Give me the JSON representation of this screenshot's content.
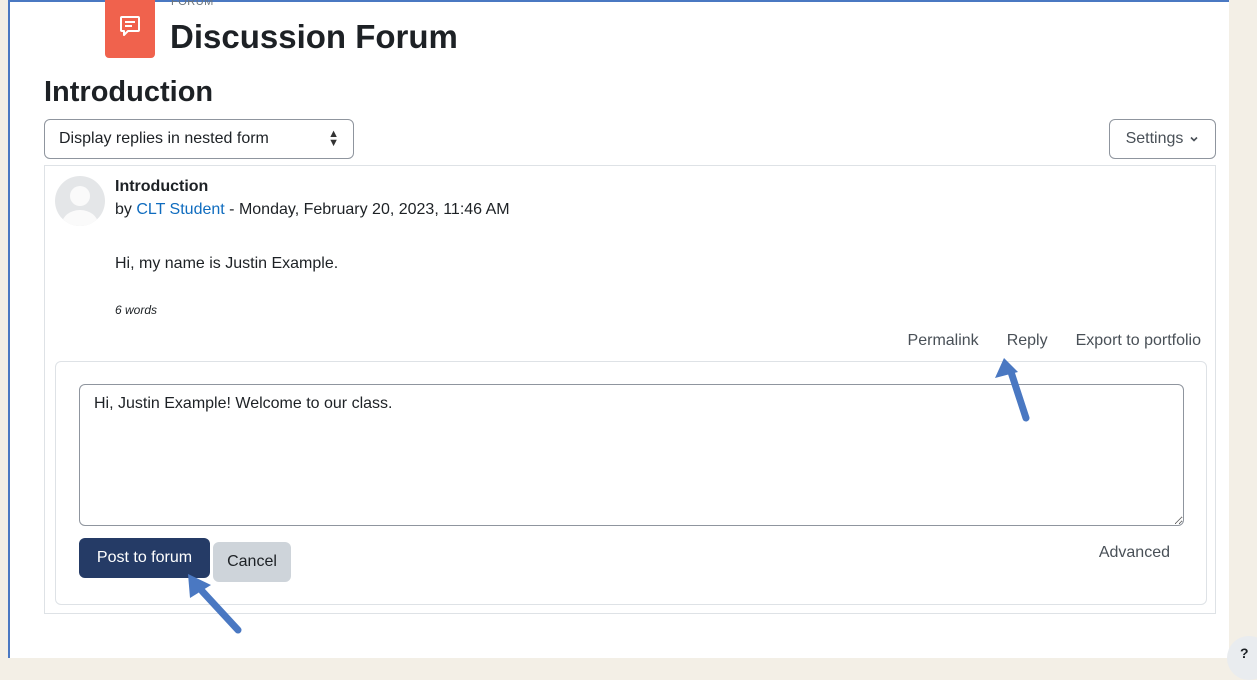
{
  "header": {
    "module_kicker": "FORUM",
    "forum_title": "Discussion Forum",
    "forum_icon": "chat-bubble-icon"
  },
  "discussion": {
    "title": "Introduction",
    "display_mode": "Display replies in nested form",
    "settings_label": "Settings"
  },
  "post": {
    "subject": "Introduction",
    "by_prefix": "by",
    "author": "CLT Student",
    "date_separator": "-",
    "date": "Monday, February 20, 2023, 11:46 AM",
    "body": "Hi, my name is Justin Example.",
    "word_count": "6 words",
    "actions": {
      "permalink": "Permalink",
      "reply": "Reply",
      "export": "Export to portfolio"
    }
  },
  "reply_form": {
    "text": "Hi, Justin Example! Welcome to our class.",
    "post_label": "Post to forum",
    "cancel_label": "Cancel",
    "advanced_label": "Advanced"
  },
  "help": {
    "label": "?"
  },
  "colors": {
    "accent_primary": "#253b66",
    "forum_icon_bg": "#f0624d",
    "link": "#0f6cbf",
    "annotation_arrow": "#4a78c2"
  }
}
